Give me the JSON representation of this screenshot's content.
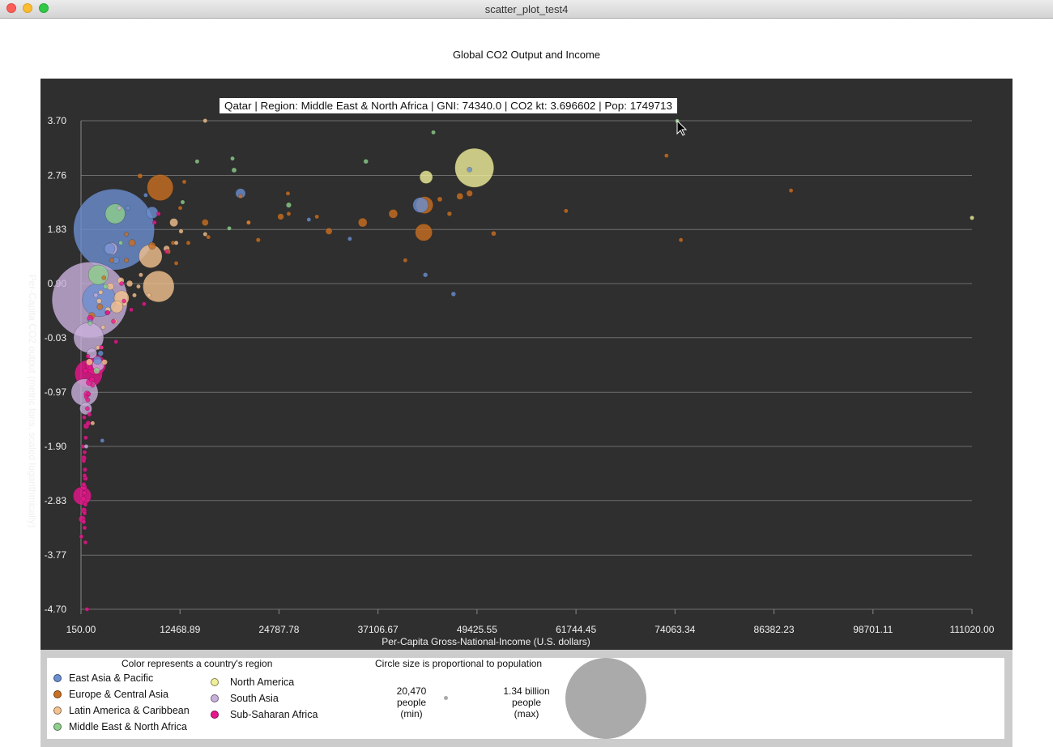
{
  "window": {
    "title": "scatter_plot_test4"
  },
  "colors": {
    "East Asia & Pacific": "#6b8fd0",
    "Europe & Central Asia": "#c96f22",
    "Latin America & Caribbean": "#f4c28e",
    "Middle East & North Africa": "#8fd08c",
    "North America": "#f0ef9a",
    "South Asia": "#c9b0dc",
    "Sub-Saharan Africa": "#e8168c"
  },
  "chart_data": {
    "type": "scatter",
    "title": "Global CO2 Output and Income",
    "xlabel": "Per-Capita Gross-National-Income (U.S. dollars)",
    "ylabel": "Per-Capita CO2 output (metric tons, scaled logarithmically)",
    "xlim": [
      150,
      111020
    ],
    "ylim": [
      -4.7,
      3.7
    ],
    "xticks": [
      "150.00",
      "12468.89",
      "24787.78",
      "37106.67",
      "49425.55",
      "61744.45",
      "74063.34",
      "86382.23",
      "98701.11",
      "111020.00"
    ],
    "yticks": [
      "3.70",
      "2.76",
      "1.83",
      "0.90",
      "-0.03",
      "-0.97",
      "-1.90",
      "-2.83",
      "-3.77",
      "-4.70"
    ],
    "grid": true,
    "tooltip": "Qatar | Region: Middle East & North Africa | GNI: 74340.0 | CO2 kt: 3.696602 | Pop: 1749713",
    "series": [
      {
        "name": "East Asia & Pacific",
        "points": [
          [
            4250,
            1.83,
            1340000000
          ],
          [
            2400,
            0.62,
            230000000
          ],
          [
            48500,
            2.86,
            5000000
          ],
          [
            42400,
            2.25,
            48000000
          ],
          [
            20000,
            2.45,
            20000000
          ],
          [
            43000,
            1.05,
            4400000
          ],
          [
            46500,
            0.72,
            4500000
          ],
          [
            33600,
            1.67,
            1500000
          ],
          [
            9000,
            2.12,
            29000000
          ],
          [
            2600,
            -0.3,
            6000000
          ],
          [
            2200,
            -0.42,
            14000000
          ],
          [
            2800,
            -1.8,
            1000000
          ],
          [
            3700,
            1.5,
            25000000
          ],
          [
            8200,
            2.42,
            100000
          ],
          [
            4500,
            1.3,
            9000000
          ],
          [
            1300,
            0.25,
            1500000
          ],
          [
            6000,
            2.2,
            4000000
          ],
          [
            28500,
            2.0,
            300000
          ]
        ]
      },
      {
        "name": "Europe & Central Asia",
        "points": [
          [
            10000,
            2.55,
            140000000
          ],
          [
            42800,
            1.78,
            60000000
          ],
          [
            42900,
            2.25,
            60000000
          ],
          [
            39000,
            2.1,
            16000000
          ],
          [
            35200,
            1.95,
            16000000
          ],
          [
            31000,
            1.8,
            9000000
          ],
          [
            47300,
            2.4,
            9000000
          ],
          [
            48500,
            2.45,
            8000000
          ],
          [
            44800,
            2.35,
            5000000
          ],
          [
            73000,
            3.1,
            700000
          ],
          [
            74800,
            1.65,
            500000
          ],
          [
            88500,
            2.5,
            600000
          ],
          [
            60500,
            2.15,
            2000000
          ],
          [
            51500,
            1.76,
            5000000
          ],
          [
            46000,
            2.1,
            4500000
          ],
          [
            40500,
            1.3,
            400000
          ],
          [
            25000,
            2.05,
            8000000
          ],
          [
            26000,
            2.1,
            3000000
          ],
          [
            25900,
            2.45,
            1500000
          ],
          [
            21000,
            1.95,
            1000000
          ],
          [
            22200,
            1.65,
            4000000
          ],
          [
            20000,
            2.4,
            2000000
          ],
          [
            15600,
            1.95,
            9000000
          ],
          [
            16000,
            1.7,
            3000000
          ],
          [
            13000,
            2.65,
            1000000
          ],
          [
            11600,
            1.6,
            2500000
          ],
          [
            9000,
            1.55,
            10000000
          ],
          [
            11000,
            1.45,
            5000000
          ],
          [
            7500,
            2.75,
            5000000
          ],
          [
            12500,
            2.2,
            3000000
          ],
          [
            13500,
            1.6,
            2000000
          ],
          [
            5800,
            1.75,
            3000000
          ],
          [
            4000,
            1.3,
            4000000
          ],
          [
            6500,
            1.6,
            9000000
          ],
          [
            3000,
            1.0,
            3000000
          ],
          [
            2500,
            0.5,
            7000000
          ],
          [
            1500,
            0.35,
            8000000
          ],
          [
            5800,
            1.3,
            4000000
          ],
          [
            12000,
            1.25,
            1000000
          ],
          [
            29500,
            2.05,
            1000000
          ]
        ]
      },
      {
        "name": "Latin America & Caribbean",
        "points": [
          [
            9800,
            0.85,
            200000000
          ],
          [
            8800,
            1.37,
            110000000
          ],
          [
            15600,
            3.7,
            1000000
          ],
          [
            11700,
            1.95,
            14000000
          ],
          [
            10800,
            1.5,
            8000000
          ],
          [
            12600,
            1.8,
            4000000
          ],
          [
            12000,
            1.6,
            1500000
          ],
          [
            15600,
            1.75,
            1000000
          ],
          [
            21000,
            1.95,
            2000000
          ],
          [
            5200,
            0.65,
            45000000
          ],
          [
            4600,
            0.5,
            30000000
          ],
          [
            3800,
            0.85,
            10000000
          ],
          [
            6200,
            0.9,
            8000000
          ],
          [
            5100,
            0.95,
            9000000
          ],
          [
            2600,
            0.75,
            4000000
          ],
          [
            3500,
            0.45,
            6000000
          ],
          [
            4300,
            0.25,
            6000000
          ],
          [
            6800,
            0.7,
            2000000
          ],
          [
            7300,
            0.85,
            3000000
          ],
          [
            2900,
            0.15,
            2000000
          ],
          [
            2300,
            -0.2,
            4000000
          ],
          [
            2700,
            -0.2,
            3000000
          ],
          [
            1200,
            -0.45,
            9000000
          ],
          [
            3100,
            -0.45,
            6000000
          ],
          [
            1600,
            -1.5,
            1000000
          ],
          [
            7600,
            1.05,
            500000
          ],
          [
            8600,
            0.7,
            1500000
          ],
          [
            2400,
            0.6,
            5000000
          ],
          [
            5600,
            0.55,
            2000000
          ]
        ]
      },
      {
        "name": "Middle East & North Africa",
        "points": [
          [
            74340,
            3.696602,
            1749713
          ],
          [
            44000,
            3.5,
            2800000
          ],
          [
            35600,
            3.0,
            4500000
          ],
          [
            19000,
            3.05,
            2500000
          ],
          [
            19200,
            2.85,
            5000000
          ],
          [
            14600,
            3.0,
            3000000
          ],
          [
            12800,
            2.3,
            3000000
          ],
          [
            26000,
            2.25,
            5500000
          ],
          [
            18600,
            1.85,
            3500000
          ],
          [
            4400,
            2.1,
            80000000
          ],
          [
            2300,
            1.05,
            80000000
          ],
          [
            2100,
            -0.6,
            8000000
          ],
          [
            1300,
            0.22,
            1000000
          ],
          [
            3200,
            0.85,
            5000000
          ],
          [
            5100,
            1.6,
            3000000
          ]
        ]
      },
      {
        "name": "North America",
        "points": [
          [
            49100,
            2.89,
            310000000
          ],
          [
            43100,
            2.73,
            34000000
          ],
          [
            111020,
            2.03,
            500000
          ]
        ]
      },
      {
        "name": "South Asia",
        "points": [
          [
            1250,
            0.62,
            1170000000
          ],
          [
            1100,
            -0.03,
            184000000
          ],
          [
            600,
            -0.97,
            148000000
          ],
          [
            750,
            -1.25,
            30000000
          ],
          [
            800,
            -1.9,
            2500000
          ],
          [
            2000,
            0.7,
            300000
          ],
          [
            4900,
            2.2,
            350000
          ],
          [
            1500,
            -0.3,
            21000000
          ],
          [
            3900,
            1.5,
            30000000
          ],
          [
            2300,
            -0.5,
            28000000
          ]
        ]
      },
      {
        "name": "Sub-Saharan Africa",
        "points": [
          [
            1100,
            -0.65,
            158000000
          ],
          [
            2000,
            -0.5,
            83000000
          ],
          [
            900,
            -1.0,
            8000000
          ],
          [
            1050,
            -1.5,
            5000000
          ],
          [
            1200,
            -1.35,
            4000000
          ],
          [
            500,
            -2.1,
            6000000
          ],
          [
            700,
            -2.45,
            5000000
          ],
          [
            500,
            -2.6,
            8000000
          ],
          [
            300,
            -2.75,
            68000000
          ],
          [
            700,
            -2.9,
            3000000
          ],
          [
            300,
            -3.15,
            10000000
          ],
          [
            500,
            -3.2,
            3000000
          ],
          [
            600,
            -3.3,
            2500000
          ],
          [
            200,
            -3.45,
            1000000
          ],
          [
            900,
            -4.7,
            300000
          ],
          [
            1000,
            -1.1,
            4000000
          ],
          [
            1200,
            -0.8,
            9000000
          ],
          [
            1000,
            -0.35,
            3500000
          ],
          [
            2700,
            -0.2,
            2000000
          ],
          [
            3400,
            0.4,
            4000000
          ],
          [
            4500,
            -0.1,
            2500000
          ],
          [
            6400,
            0.45,
            1000000
          ],
          [
            5500,
            0.6,
            1500000
          ],
          [
            9300,
            1.95,
            1500000
          ],
          [
            9800,
            2.1,
            1200000
          ],
          [
            10800,
            1.45,
            100000
          ],
          [
            800,
            -1.55,
            7000000
          ],
          [
            750,
            -1.75,
            3000000
          ],
          [
            600,
            -2.0,
            2000000
          ],
          [
            650,
            -2.3,
            4000000
          ],
          [
            600,
            -2.4,
            1500000
          ],
          [
            500,
            -2.55,
            2000000
          ],
          [
            550,
            -2.7,
            4000000
          ],
          [
            550,
            -1.4,
            3000000
          ],
          [
            700,
            -0.6,
            5000000
          ],
          [
            1500,
            -0.75,
            6000000
          ],
          [
            800,
            -1.05,
            2500000
          ],
          [
            950,
            -1.25,
            2000000
          ],
          [
            1100,
            -1.0,
            3000000
          ],
          [
            1600,
            -0.85,
            2000000
          ],
          [
            1300,
            -0.55,
            1500000
          ],
          [
            1300,
            0.3,
            8000000
          ],
          [
            3500,
            0.4,
            1000000
          ],
          [
            4200,
            0.25,
            1500000
          ],
          [
            500,
            -3.0,
            7000000
          ],
          [
            600,
            -3.05,
            2500000
          ],
          [
            700,
            -3.55,
            1500000
          ],
          [
            400,
            -1.9,
            3000000
          ],
          [
            450,
            -2.8,
            5000000
          ],
          [
            500,
            -2.15,
            1000000
          ],
          [
            5200,
            0.9,
            2000000
          ],
          [
            8000,
            0.55,
            1000000
          ]
        ]
      }
    ]
  },
  "legend": {
    "color_header": "Color represents a country's region",
    "regions": [
      "East Asia & Pacific",
      "Europe & Central Asia",
      "Latin America & Caribbean",
      "Middle East & North Africa",
      "North America",
      "South Asia",
      "Sub-Saharan Africa"
    ],
    "size_header": "Circle size is proportional to population",
    "min_label": [
      "20,470",
      "people",
      "(min)"
    ],
    "max_label": [
      "1.34 billion",
      "people",
      "(max)"
    ],
    "marker_color": "#aaaaaa"
  }
}
